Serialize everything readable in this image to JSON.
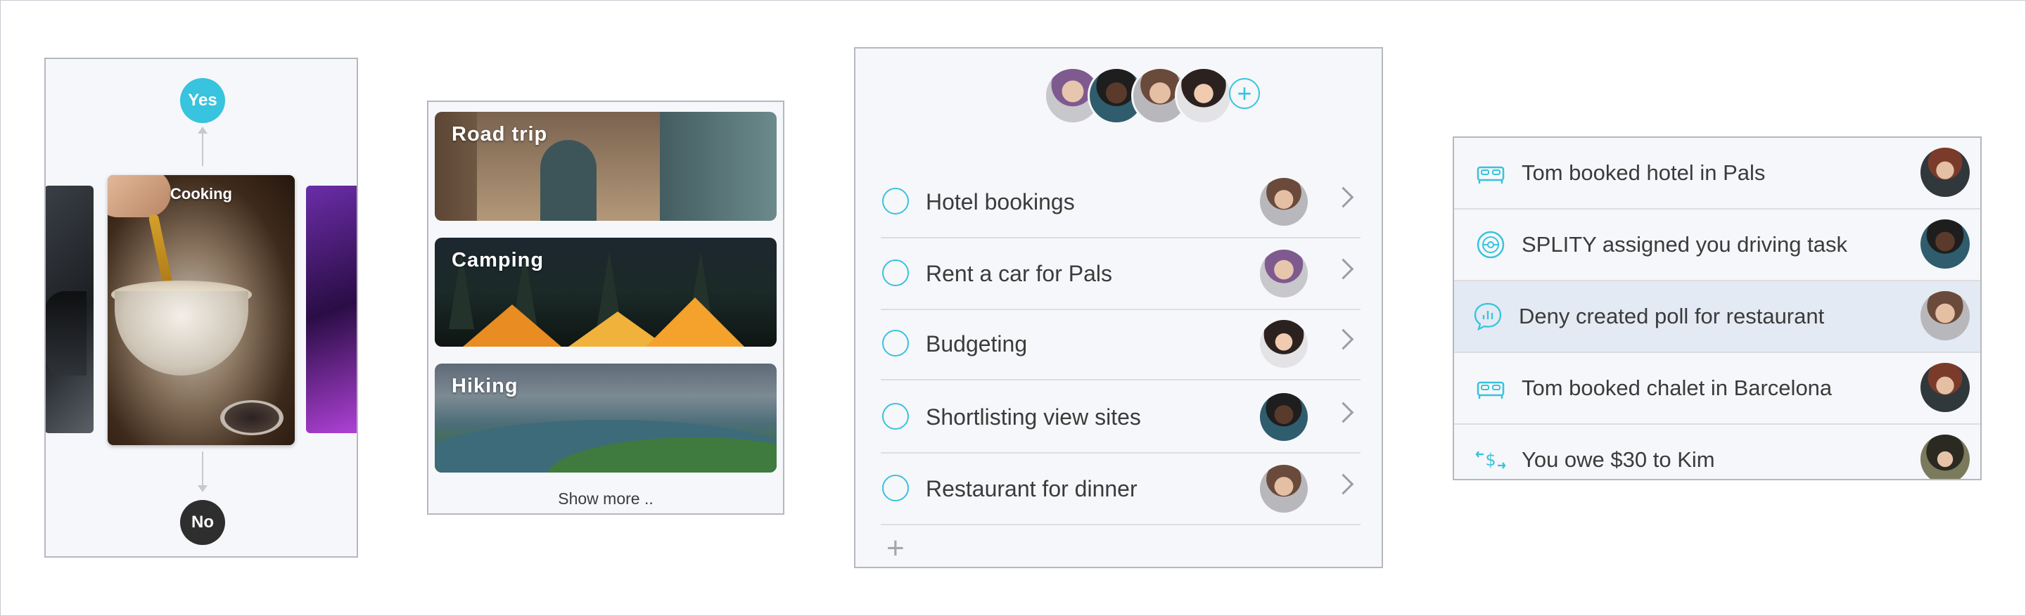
{
  "colors": {
    "accent": "#38c3de",
    "dark": "#2e2e2e",
    "text": "#3b3b3b",
    "highlight": "#e3eaf3"
  },
  "swipe": {
    "yes_label": "Yes",
    "no_label": "No",
    "card_title": "Cooking"
  },
  "categories": {
    "items": [
      {
        "label": "Road trip"
      },
      {
        "label": "Camping"
      },
      {
        "label": "Hiking"
      }
    ],
    "show_more": "Show more .."
  },
  "tasks": {
    "members": [
      "avatar",
      "avatar",
      "avatar",
      "avatar"
    ],
    "add_member_icon": "plus-circle-icon",
    "items": [
      {
        "label": "Hotel bookings"
      },
      {
        "label": "Rent a car for Pals"
      },
      {
        "label": "Budgeting"
      },
      {
        "label": "Shortlisting view sites"
      },
      {
        "label": "Restaurant for dinner"
      }
    ],
    "add_task_icon": "plus-icon"
  },
  "activity": {
    "items": [
      {
        "icon": "bed-icon",
        "label": "Tom booked hotel in Pals"
      },
      {
        "icon": "steering-wheel-icon",
        "label": "SPLITY assigned you driving task"
      },
      {
        "icon": "poll-chat-icon",
        "label": "Deny created poll for restaurant",
        "highlighted": true
      },
      {
        "icon": "bed-icon",
        "label": "Tom booked chalet in Barcelona"
      },
      {
        "icon": "money-transfer-icon",
        "label": "You owe $30 to Kim"
      }
    ]
  }
}
